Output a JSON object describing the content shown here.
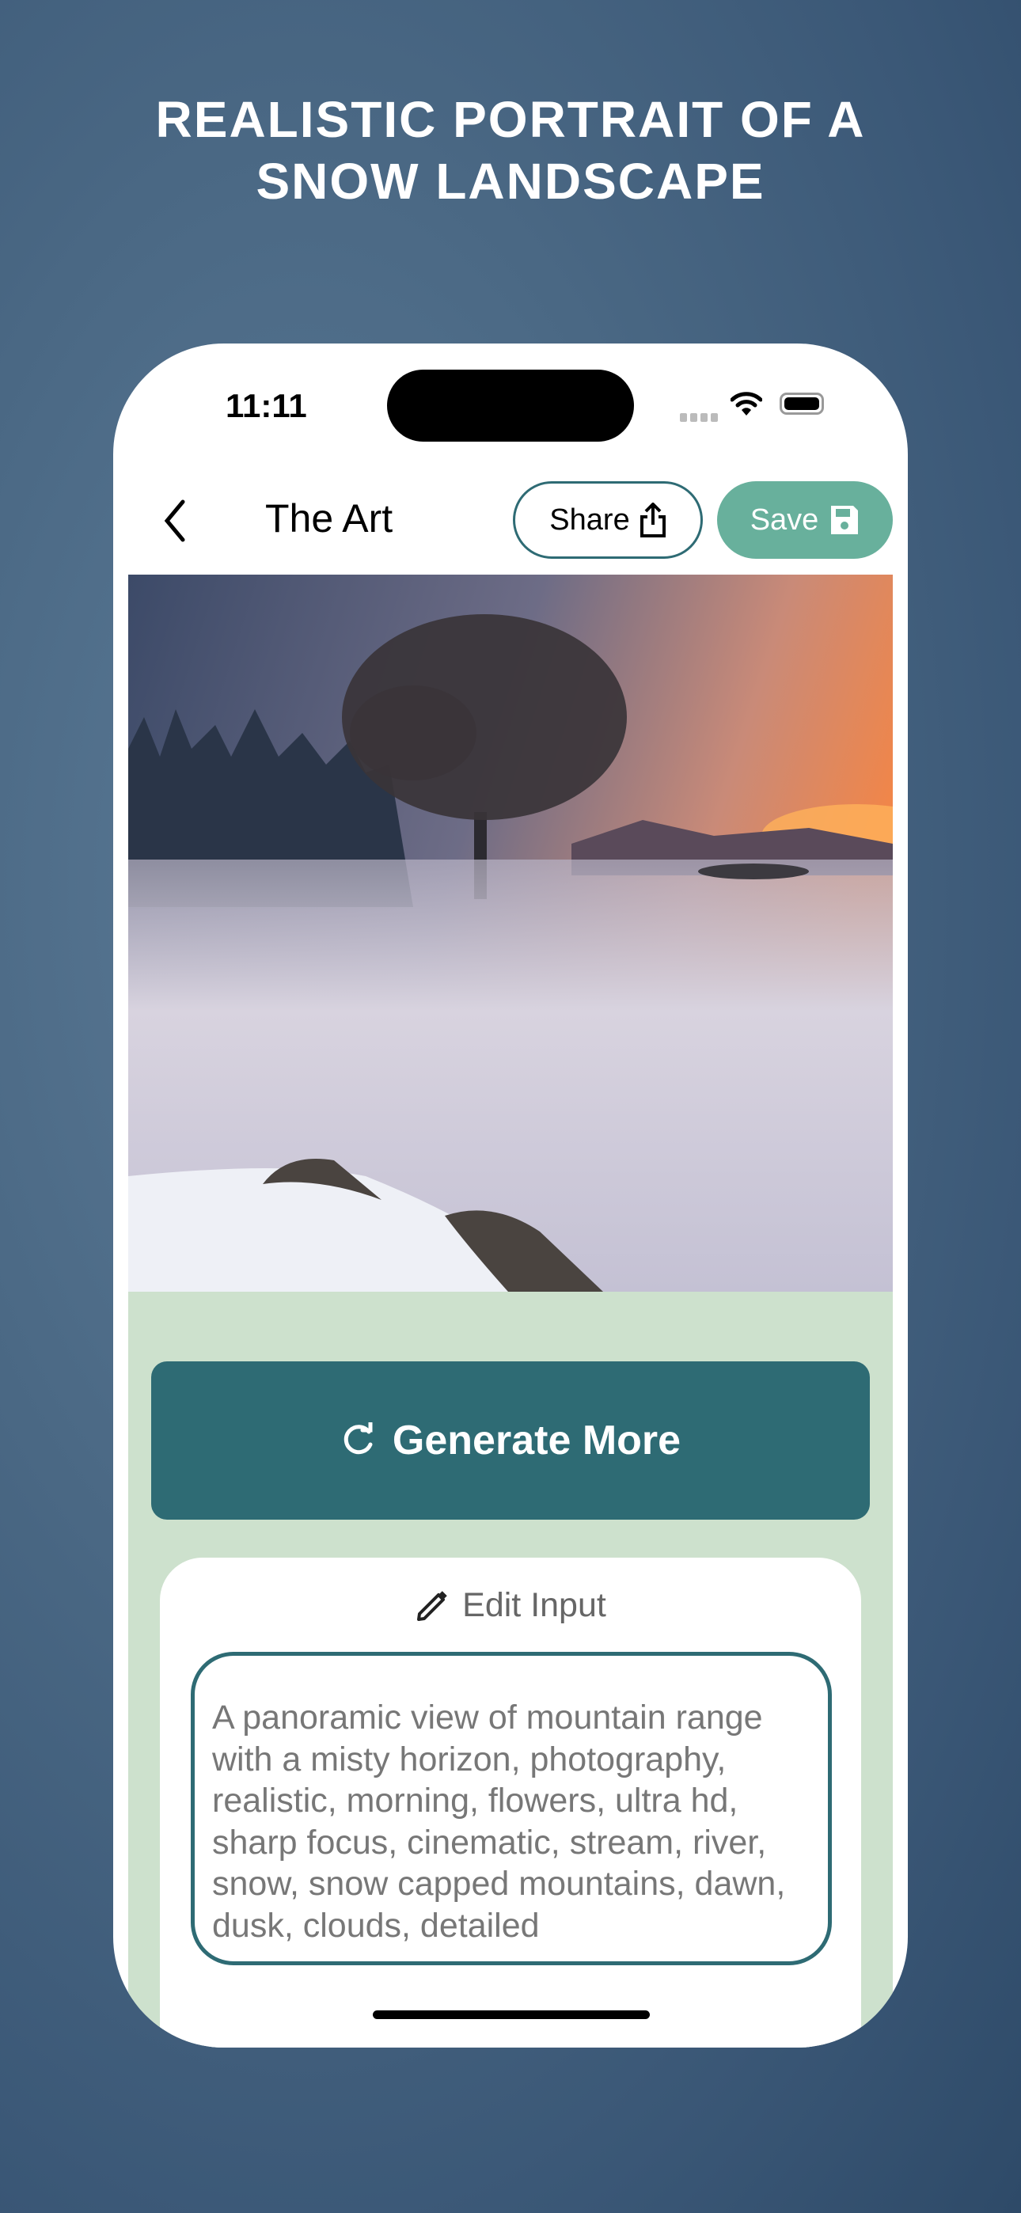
{
  "headline": {
    "line1": "REALISTIC PORTRAIT OF A",
    "line2": "SNOW LANDSCAPE"
  },
  "status_bar": {
    "time": "11:11",
    "icons": [
      "signal-icon",
      "wifi-icon",
      "battery-icon"
    ]
  },
  "nav": {
    "back_icon": "chevron-left-icon",
    "title": "The Art",
    "share_label": "Share",
    "save_label": "Save"
  },
  "image": {
    "description_icon": "generated-art-image"
  },
  "actions": {
    "generate_label": "Generate More"
  },
  "edit": {
    "label": "Edit Input",
    "prompt": "A panoramic view of mountain range with a misty horizon, photography, realistic, morning, flowers, ultra hd, sharp focus, cinematic, stream, river, snow, snow capped mountains, dawn, dusk, clouds, detailed"
  },
  "colors": {
    "accent": "#2e6b74",
    "save": "#68b09c",
    "panel": "#cde1cd"
  }
}
